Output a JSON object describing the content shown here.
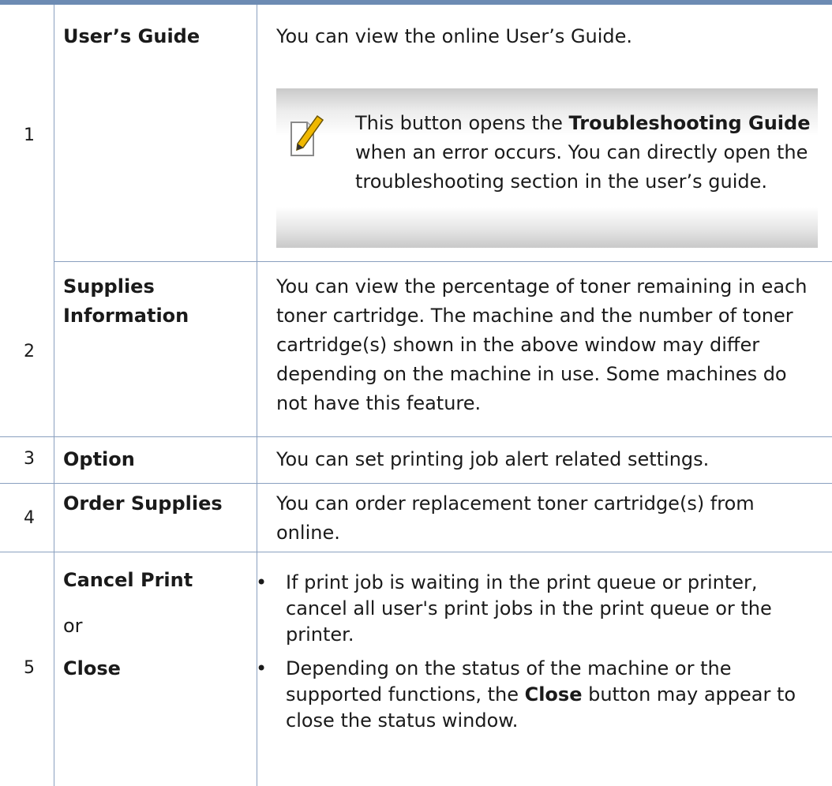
{
  "rows": [
    {
      "number": "1",
      "name": "User’s Guide",
      "description": "You can view the online User’s Guide.",
      "note": {
        "text_before": "This button opens the ",
        "bold": "Troubleshooting Guide",
        "text_after": " when an error occurs. You can directly open the troubleshooting section in the user’s guide."
      }
    },
    {
      "number": "2",
      "name": "Supplies Information",
      "description": "You can view the percentage of toner remaining in each toner cartridge. The machine and the number of toner cartridge(s) shown in the above window may differ depending on the machine in use. Some machines do not have this feature."
    },
    {
      "number": "3",
      "name": "Option",
      "description": "You can set printing job alert related settings."
    },
    {
      "number": "4",
      "name": "Order Supplies",
      "description": "You can order replacement toner cartridge(s) from online."
    },
    {
      "number": "5",
      "name_1": "Cancel Print",
      "or": "or",
      "name_2": "Close",
      "bullets": [
        {
          "text": "If print job is waiting in the print queue or printer, cancel all user's print jobs in the print queue or the printer."
        },
        {
          "text_before": "Depending on the status of the machine or the supported functions, the ",
          "bold": "Close",
          "text_after": " button may appear to close the status window."
        }
      ],
      "bullet_char": "•"
    }
  ]
}
